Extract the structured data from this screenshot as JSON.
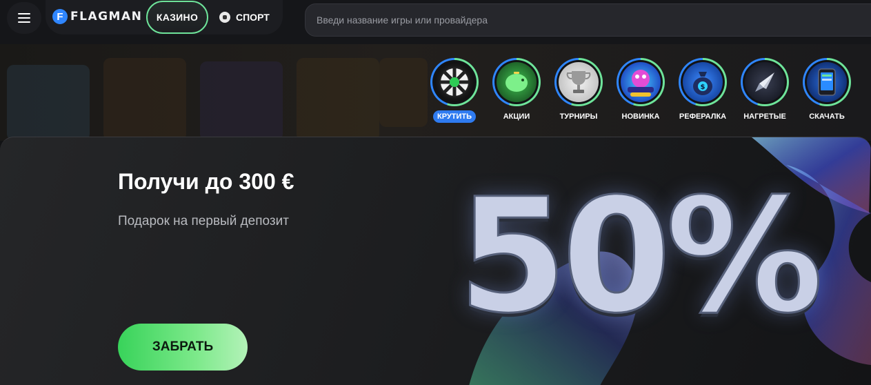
{
  "header": {
    "menu_icon": "hamburger-icon",
    "logo_mark": "F",
    "logo_text": "FLAGMAN",
    "tabs": {
      "casino": "КАЗИНО",
      "sport": "СПОРТ"
    },
    "sport_icon": "football-icon",
    "search_placeholder": "Введи название игры или провайдера"
  },
  "stories": [
    {
      "label": "КРУТИТЬ",
      "icon": "wheel-icon",
      "active": true
    },
    {
      "label": "АКЦИИ",
      "icon": "piggy-bank-icon"
    },
    {
      "label": "ТУРНИРЫ",
      "icon": "trophy-icon"
    },
    {
      "label": "НОВИНКА",
      "icon": "flagman-frenzy-icon"
    },
    {
      "label": "РЕФЕРАЛКА",
      "icon": "money-bag-icon"
    },
    {
      "label": "НАГРЕТЫЕ",
      "icon": "rocket-icon"
    },
    {
      "label": "СКАЧАТЬ",
      "icon": "phone-icon"
    }
  ],
  "banner": {
    "title": "Получи до 300 €",
    "subtitle": "Подарок на первый депозит",
    "cta": "ЗАБРАТЬ",
    "percent": "50%"
  },
  "colors": {
    "accent_green": "#6ee49a",
    "accent_blue": "#2f7bf0",
    "cta_green": "#38d35a"
  }
}
